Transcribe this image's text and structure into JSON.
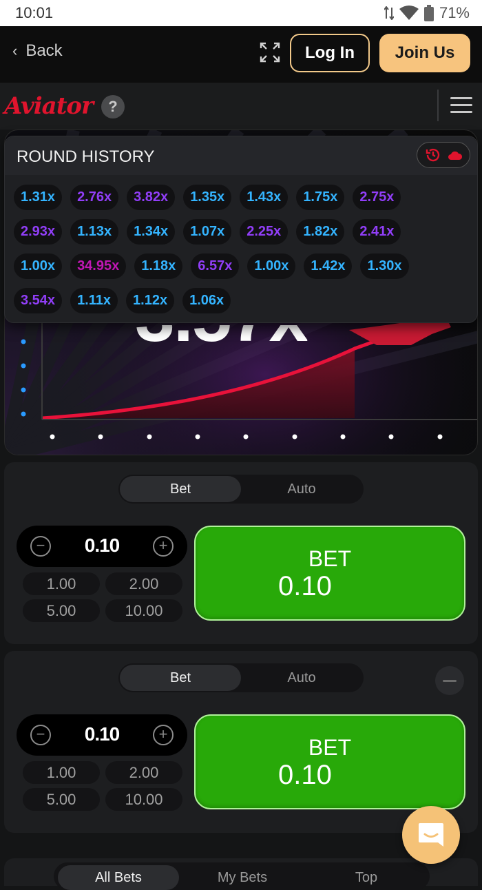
{
  "status": {
    "time": "10:01",
    "battery": "71%"
  },
  "nav": {
    "back_label": "Back",
    "login_label": "Log In",
    "join_label": "Join Us"
  },
  "game": {
    "logo": "Aviator",
    "help": "?",
    "multiplier": "3.57x"
  },
  "history": {
    "title": "ROUND HISTORY",
    "rows": [
      [
        {
          "v": "1.31x",
          "c": "blue"
        },
        {
          "v": "2.76x",
          "c": "purple"
        },
        {
          "v": "3.82x",
          "c": "purple"
        },
        {
          "v": "1.35x",
          "c": "blue"
        },
        {
          "v": "1.43x",
          "c": "blue"
        },
        {
          "v": "1.75x",
          "c": "blue"
        },
        {
          "v": "2.75x",
          "c": "purple"
        }
      ],
      [
        {
          "v": "2.93x",
          "c": "purple"
        },
        {
          "v": "1.13x",
          "c": "blue"
        },
        {
          "v": "1.34x",
          "c": "blue"
        },
        {
          "v": "1.07x",
          "c": "blue"
        },
        {
          "v": "2.25x",
          "c": "purple"
        },
        {
          "v": "1.82x",
          "c": "blue"
        },
        {
          "v": "2.41x",
          "c": "purple"
        }
      ],
      [
        {
          "v": "1.00x",
          "c": "blue"
        },
        {
          "v": "34.95x",
          "c": "pink"
        },
        {
          "v": "1.18x",
          "c": "blue"
        },
        {
          "v": "6.57x",
          "c": "purple"
        },
        {
          "v": "1.00x",
          "c": "blue"
        },
        {
          "v": "1.42x",
          "c": "blue"
        },
        {
          "v": "1.30x",
          "c": "blue"
        }
      ],
      [
        {
          "v": "3.54x",
          "c": "purple"
        },
        {
          "v": "1.11x",
          "c": "blue"
        },
        {
          "v": "1.12x",
          "c": "blue"
        },
        {
          "v": "1.06x",
          "c": "blue"
        }
      ]
    ]
  },
  "bet1": {
    "tab_bet": "Bet",
    "tab_auto": "Auto",
    "amount": "0.10",
    "quick": [
      "1.00",
      "2.00",
      "5.00",
      "10.00"
    ],
    "button_label": "BET",
    "button_amount": "0.10"
  },
  "bet2": {
    "tab_bet": "Bet",
    "tab_auto": "Auto",
    "amount": "0.10",
    "quick": [
      "1.00",
      "2.00",
      "5.00",
      "10.00"
    ],
    "button_label": "BET",
    "button_amount": "0.10"
  },
  "bottom_tabs": {
    "all": "All Bets",
    "my": "My Bets",
    "top": "Top"
  },
  "colors": {
    "accent": "#f7c47e",
    "bet_green": "#28a909",
    "logo_red": "#e0142d",
    "chip_blue": "#34b4ff",
    "chip_purple": "#913ef8",
    "chip_pink": "#c017b4"
  }
}
